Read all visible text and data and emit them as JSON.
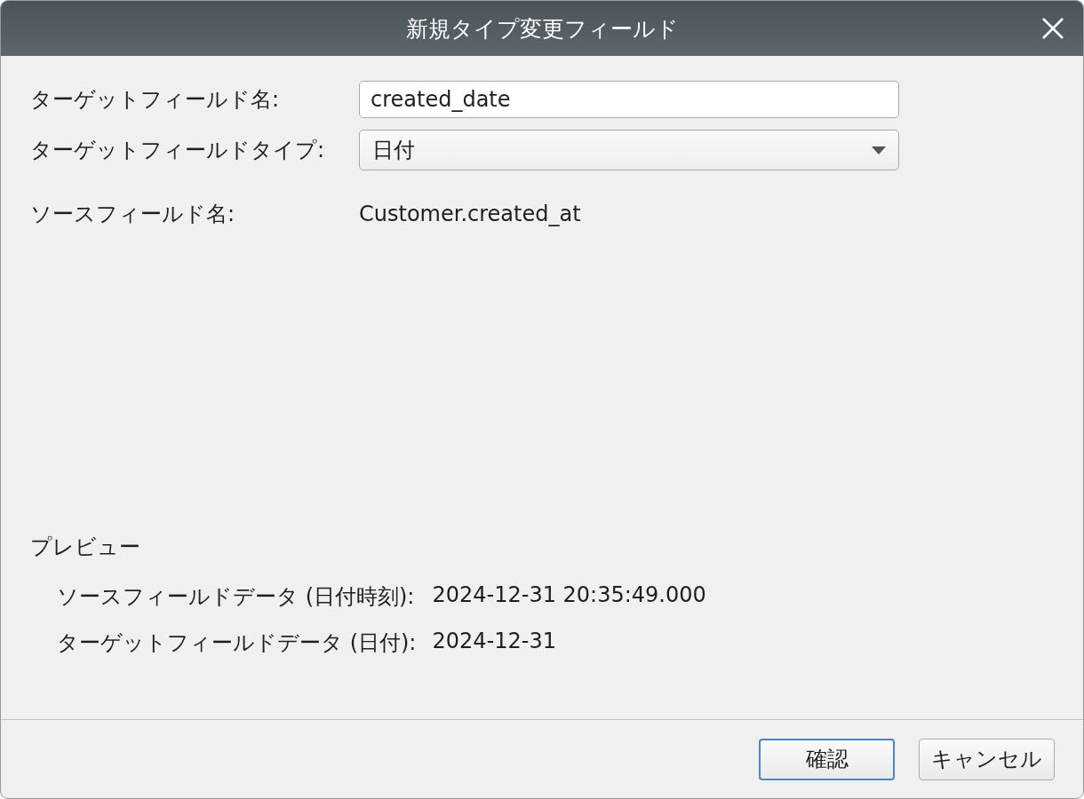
{
  "window": {
    "title": "新規タイプ変更フィールド"
  },
  "fields": [
    {
      "kind": "text",
      "label": "ターゲットフィールド名:",
      "value": "created_date"
    },
    {
      "kind": "dropdown",
      "label": "ターゲットフィールドタイプ:",
      "value": "日付"
    },
    {
      "kind": "static",
      "label": "ソースフィールド名:",
      "value": "Customer.created_at"
    }
  ],
  "preview": {
    "title": "プレビュー",
    "rows": [
      {
        "label": "ソースフィールドデータ (日付時刻):",
        "value": "2024-12-31 20:35:49.000"
      },
      {
        "label": "ターゲットフィールドデータ (日付):",
        "value": "2024-12-31"
      }
    ]
  },
  "buttons": [
    {
      "label": "確認",
      "default": true
    },
    {
      "label": "キャンセル",
      "default": false
    }
  ]
}
